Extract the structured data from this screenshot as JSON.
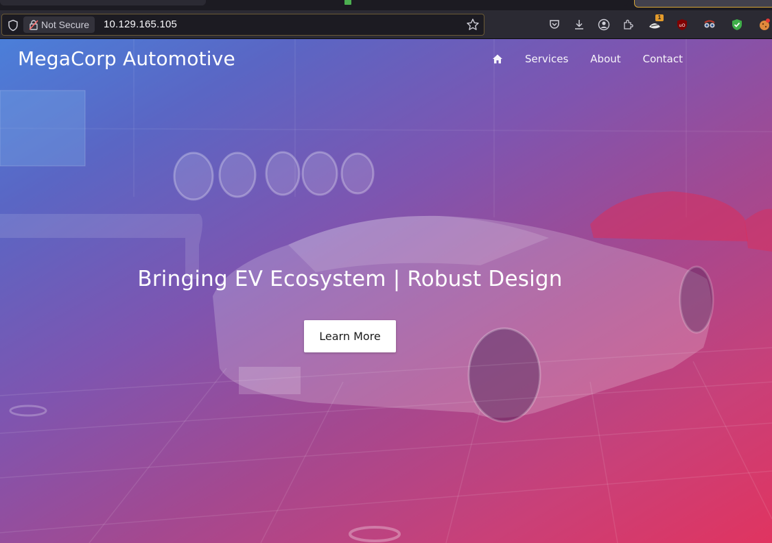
{
  "browser": {
    "security_label": "Not Secure",
    "url": "10.129.165.105",
    "extension_badge": "1"
  },
  "site": {
    "brand": "MegaCorp Automotive",
    "nav": [
      "Services",
      "About",
      "Contact"
    ],
    "hero_title": "Bringing EV Ecosystem | Robust Design",
    "cta_label": "Learn More"
  },
  "colors": {
    "gradient_start": "#4b7fd9",
    "gradient_end": "#e03460",
    "chrome_bg": "#2b2a33"
  }
}
